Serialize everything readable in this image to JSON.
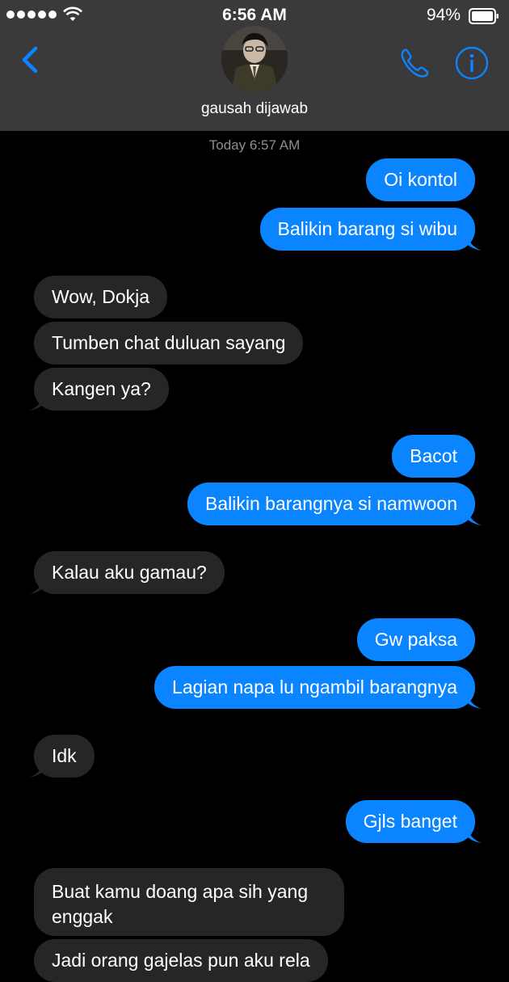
{
  "status_bar": {
    "time": "6:56 AM",
    "battery": "94%"
  },
  "header": {
    "contact_name": "gausah dijawab",
    "icons": {
      "back": "chevron-left-icon",
      "call": "phone-icon",
      "info": "info-icon"
    }
  },
  "thread": {
    "timestamp": "Today 6:57 AM",
    "messages": [
      {
        "dir": "out",
        "text": "Oi kontol"
      },
      {
        "dir": "out",
        "text": "Balikin barang si wibu"
      },
      {
        "dir": "in",
        "text": "Wow, Dokja"
      },
      {
        "dir": "in",
        "text": "Tumben chat duluan sayang"
      },
      {
        "dir": "in",
        "text": "Kangen ya?"
      },
      {
        "dir": "out",
        "text": "Bacot"
      },
      {
        "dir": "out",
        "text": "Balikin barangnya si namwoon"
      },
      {
        "dir": "in",
        "text": "Kalau aku gamau?"
      },
      {
        "dir": "out",
        "text": "Gw paksa"
      },
      {
        "dir": "out",
        "text": "Lagian napa lu ngambil barangnya"
      },
      {
        "dir": "in",
        "text": "Idk"
      },
      {
        "dir": "out",
        "text": "Gjls banget"
      },
      {
        "dir": "in",
        "text": "Buat kamu doang apa sih yang enggak"
      },
      {
        "dir": "in",
        "text": "Jadi orang gajelas pun aku rela"
      }
    ]
  },
  "colors": {
    "outgoing_bubble": "#0a84ff",
    "incoming_bubble": "#262628",
    "accent": "#0a84ff",
    "header_bg": "#3a3a3c"
  }
}
